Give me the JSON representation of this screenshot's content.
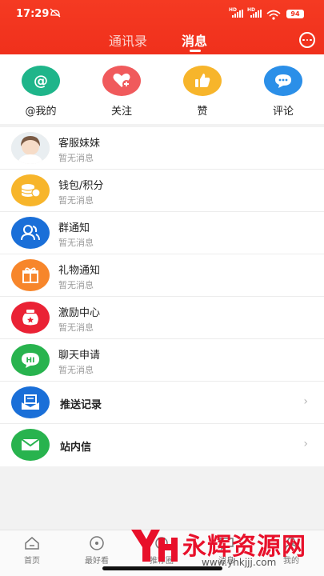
{
  "status_bar": {
    "time": "17:29",
    "battery": "94"
  },
  "header": {
    "tabs": [
      {
        "label": "通讯录",
        "active": false
      },
      {
        "label": "消息",
        "active": true
      }
    ]
  },
  "quick_actions": [
    {
      "label": "@我的",
      "icon": "at-icon",
      "color": "#1fb58a"
    },
    {
      "label": "关注",
      "icon": "heart-plus-icon",
      "color": "#f05a5c"
    },
    {
      "label": "赞",
      "icon": "thumbs-up-icon",
      "color": "#f7b52b"
    },
    {
      "label": "评论",
      "icon": "comment-icon",
      "color": "#2b8fe8"
    }
  ],
  "messages": [
    {
      "title": "客服妹妹",
      "subtitle": "暂无消息",
      "icon": "avatar"
    },
    {
      "title": "钱包/积分",
      "subtitle": "暂无消息",
      "icon": "coins-icon",
      "color": "#f7b52b"
    },
    {
      "title": "群通知",
      "subtitle": "暂无消息",
      "icon": "group-icon",
      "color": "#1a6fd8"
    },
    {
      "title": "礼物通知",
      "subtitle": "暂无消息",
      "icon": "gift-icon",
      "color": "#f7862b"
    },
    {
      "title": "激励中心",
      "subtitle": "暂无消息",
      "icon": "pot-icon",
      "color": "#ea2235"
    },
    {
      "title": "聊天申请",
      "subtitle": "暂无消息",
      "icon": "hi-chat-icon",
      "color": "#28b34e"
    },
    {
      "title": "推送记录",
      "icon": "inbox-icon",
      "color": "#1a6fd8"
    },
    {
      "title": "站内信",
      "icon": "mail-icon",
      "color": "#28b34e"
    }
  ],
  "tabbar": [
    {
      "label": "首页",
      "icon": "home-icon"
    },
    {
      "label": "最好看",
      "icon": "play-icon"
    },
    {
      "label": "推荐圈",
      "icon": "circle-icon"
    },
    {
      "label": "消息",
      "icon": "message-icon"
    },
    {
      "label": "我的",
      "icon": "profile-icon"
    }
  ],
  "watermark": {
    "title": "永辉资源网",
    "url": "www.yhkjjj.com"
  }
}
